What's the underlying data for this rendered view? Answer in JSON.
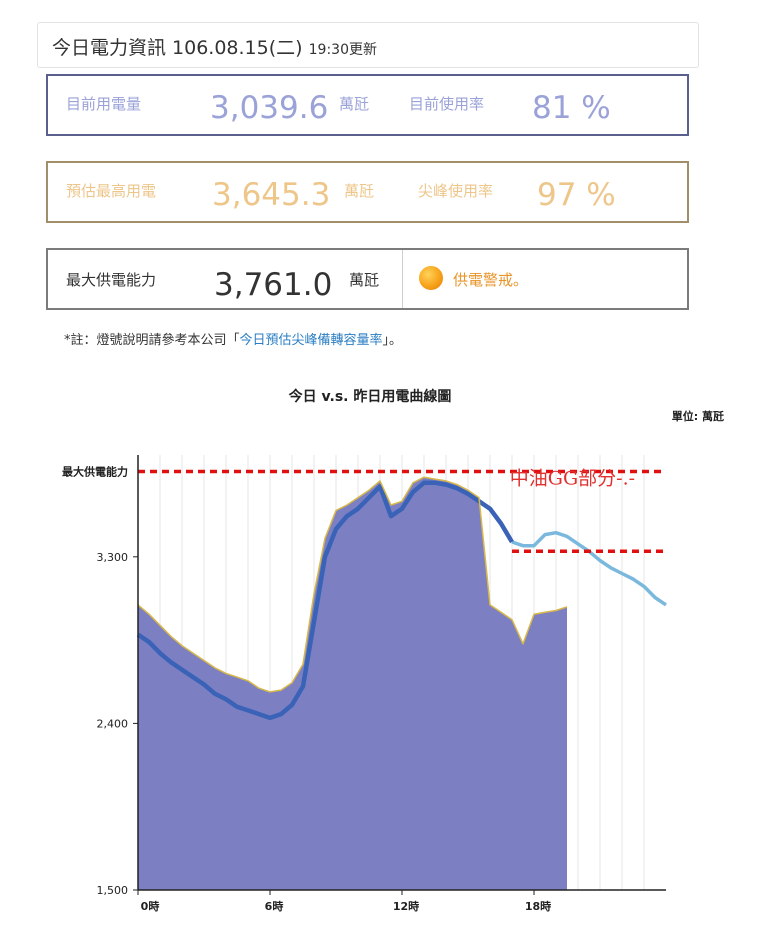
{
  "header": {
    "title": "今日電力資訊 106.08.15(二)",
    "updated": "19:30更新"
  },
  "current": {
    "label": "目前用電量",
    "value": "3,039.6",
    "unit": "萬瓩",
    "rate_label": "目前使用率",
    "rate": "81 %"
  },
  "forecast": {
    "label": "預估最高用電",
    "value": "3,645.3",
    "unit": "萬瓩",
    "rate_label": "尖峰使用率",
    "rate": "97 %"
  },
  "supply": {
    "label": "最大供電能力",
    "value": "3,761.0",
    "unit": "萬瓩",
    "status": "供電警戒。",
    "status_color": "#e8952a"
  },
  "note": {
    "prefix": "*註：燈號說明請參考本公司「",
    "link": "今日預估尖峰備轉容量率",
    "suffix": "」。"
  },
  "chart_data": {
    "type": "area",
    "title": "今日 v.s. 昨日用電曲線圖",
    "unit_label": "單位: 萬瓩",
    "ylim": [
      1500,
      3850
    ],
    "xlim": [
      0,
      24
    ],
    "yticks": [
      {
        "value": 1500,
        "label": "1,500"
      },
      {
        "value": 2400,
        "label": "2,400"
      },
      {
        "value": 3300,
        "label": "3,300"
      }
    ],
    "xticks": [
      {
        "value": 0,
        "label": "0時"
      },
      {
        "value": 6,
        "label": "6時"
      },
      {
        "value": 12,
        "label": "12時"
      },
      {
        "value": 18,
        "label": "18時"
      }
    ],
    "reference_lines": [
      {
        "name": "最大供電能力",
        "value": 3761
      },
      {
        "name": "",
        "value": 3330,
        "x_start": 17
      }
    ],
    "annotation": "中油GG部分-.-",
    "colors": {
      "today_fill": "#7c80c2",
      "today_edge": "#d8b84a",
      "yesterday": "#3a63b8",
      "yesterday_forecast": "#7ab8dd",
      "reference": "#e01010"
    },
    "series": [
      {
        "key": "today",
        "x": [
          0,
          0.5,
          1,
          1.5,
          2,
          2.5,
          3,
          3.5,
          4,
          4.5,
          5,
          5.5,
          6,
          6.5,
          7,
          7.5,
          8,
          8.5,
          9,
          9.5,
          10,
          10.5,
          11,
          11.5,
          12,
          12.5,
          13,
          13.5,
          14,
          14.5,
          15,
          15.5,
          16,
          16.5,
          17,
          17.5,
          18,
          18.5,
          19,
          19.5
        ],
        "values": [
          3040,
          2990,
          2930,
          2870,
          2820,
          2780,
          2740,
          2700,
          2670,
          2650,
          2630,
          2590,
          2570,
          2580,
          2620,
          2720,
          3100,
          3400,
          3550,
          3580,
          3620,
          3660,
          3710,
          3580,
          3600,
          3700,
          3730,
          3720,
          3710,
          3690,
          3660,
          3620,
          3040,
          3000,
          2960,
          2830,
          2990,
          3000,
          3010,
          3030
        ]
      },
      {
        "key": "yesterday",
        "x": [
          0,
          0.5,
          1,
          1.5,
          2,
          2.5,
          3,
          3.5,
          4,
          4.5,
          5,
          5.5,
          6,
          6.5,
          7,
          7.5,
          8,
          8.5,
          9,
          9.5,
          10,
          10.5,
          11,
          11.5,
          12,
          12.5,
          13,
          13.5,
          14,
          14.5,
          15,
          15.5,
          16,
          16.5,
          17,
          17.5,
          18,
          18.5,
          19,
          19.5,
          20,
          20.5,
          21,
          21.5,
          22,
          22.5,
          23,
          23.5,
          24
        ],
        "values": [
          2880,
          2840,
          2780,
          2730,
          2690,
          2650,
          2610,
          2560,
          2530,
          2490,
          2470,
          2450,
          2430,
          2450,
          2500,
          2600,
          2950,
          3300,
          3450,
          3520,
          3560,
          3620,
          3680,
          3520,
          3560,
          3650,
          3700,
          3700,
          3690,
          3670,
          3640,
          3600,
          3560,
          3480,
          3380,
          3360,
          3360,
          3420,
          3430,
          3410,
          3370,
          3330,
          3280,
          3240,
          3210,
          3180,
          3140,
          3080,
          3040
        ]
      }
    ]
  }
}
